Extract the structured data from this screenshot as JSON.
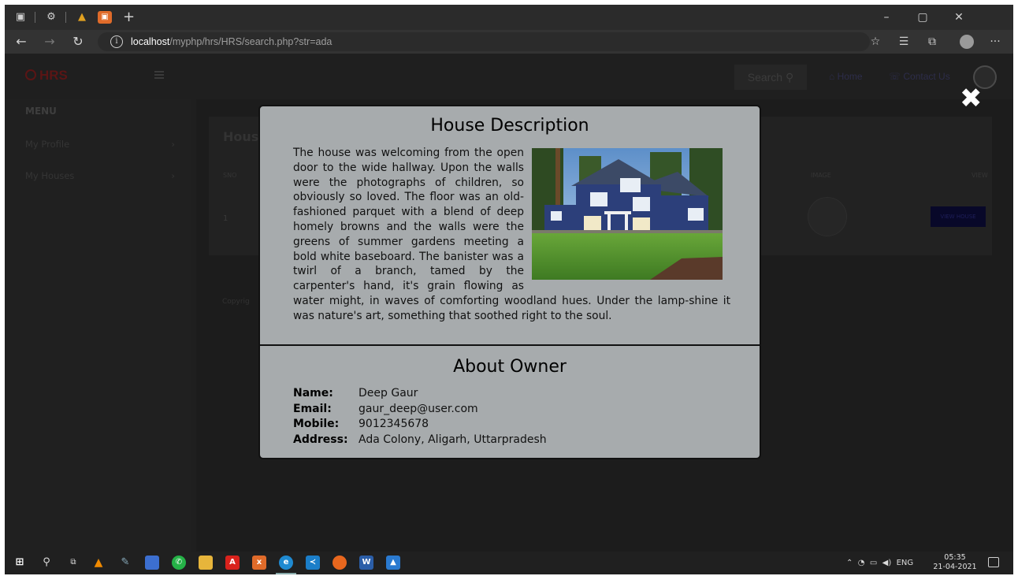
{
  "browser": {
    "url_host": "localhost",
    "url_path": "/myphp/hrs/HRS/search.php?str=ada"
  },
  "site": {
    "logo_text": "HRS",
    "search_label": "Search",
    "nav": [
      "Home",
      "Contact Us"
    ],
    "sidebar": {
      "heading": "MENU",
      "items": [
        "My Profile",
        "My Houses"
      ]
    },
    "card_title": "Hous",
    "table_headers": [
      "SNO",
      "IMAGE",
      "VIEW"
    ],
    "rows": [
      {
        "sno": "1",
        "action": "VIEW HOUSE"
      }
    ],
    "copyright": "Copyrig"
  },
  "modal": {
    "title": "House Description",
    "description": "The house was welcoming from the open door to the wide hallway. Upon the walls were the photographs of children, so obviously so loved. The floor was an old-fashioned parquet with a blend of deep homely browns and the walls were the greens of summer gardens meeting a bold white baseboard. The banister was a twirl of a branch, tamed by the carpenter's hand, it's grain flowing as water might, in waves of comforting woodland hues. Under the lamp-shine it was nature's art, something that soothed right to the soul.",
    "owner_title": "About Owner",
    "owner": [
      {
        "label": "Name:",
        "value": "Deep Gaur"
      },
      {
        "label": "Email:",
        "value": "gaur_deep@user.com"
      },
      {
        "label": "Mobile:",
        "value": "9012345678"
      },
      {
        "label": "Address:",
        "value": "Ada Colony, Aligarh, Uttarpradesh"
      }
    ]
  },
  "taskbar": {
    "language": "ENG",
    "time": "05:35",
    "date": "21-04-2021"
  }
}
